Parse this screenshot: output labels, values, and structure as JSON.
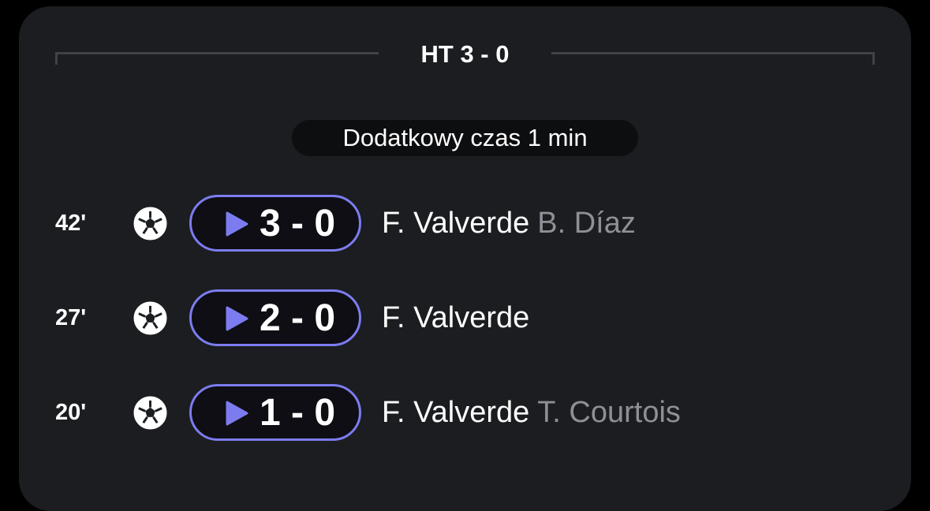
{
  "colors": {
    "card_background": "#1b1d20",
    "accent": "#7c7cf0",
    "text_primary": "#ffffff",
    "text_secondary": "#8d9096"
  },
  "half_time": {
    "label": "HT 3 - 0"
  },
  "added_time": {
    "label": "Dodatkowy czas 1 min"
  },
  "events": [
    {
      "minute": "42'",
      "icon": "football-icon",
      "score": "3 - 0",
      "scorer": "F. Valverde",
      "assist": "B. Díaz"
    },
    {
      "minute": "27'",
      "icon": "football-icon",
      "score": "2 - 0",
      "scorer": "F. Valverde",
      "assist": ""
    },
    {
      "minute": "20'",
      "icon": "football-icon",
      "score": "1 - 0",
      "scorer": "F. Valverde",
      "assist": "T. Courtois"
    }
  ]
}
